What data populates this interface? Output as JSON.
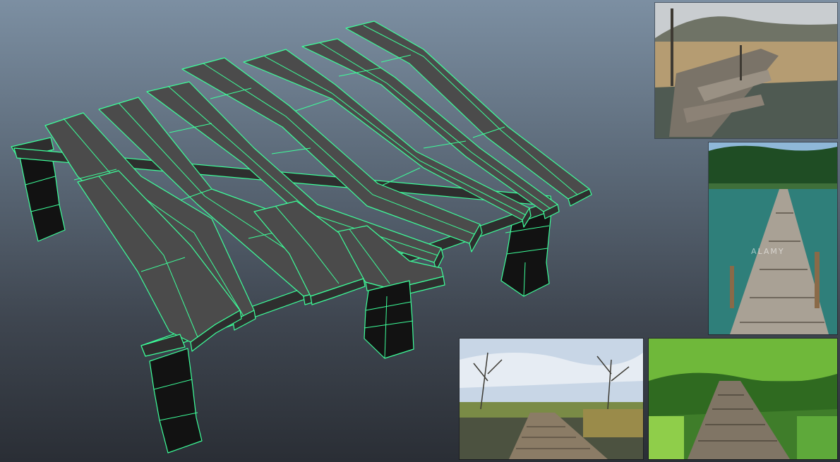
{
  "viewport": {
    "background_top": "#7c8fa2",
    "background_bottom": "#2a2e35",
    "wireframe_color": "#3dff9a",
    "plank_color": "#4a4a4a",
    "post_color": "#141414"
  },
  "model": {
    "name": "wooden-pier-mesh",
    "plank_count": 11,
    "post_count": 4
  },
  "references": [
    {
      "id": "ref-reeds-broken-dock",
      "watermark": ""
    },
    {
      "id": "ref-tropical-lake-boardwalk",
      "watermark": "ALAMY"
    },
    {
      "id": "ref-winter-marsh-boardwalk",
      "watermark": ""
    },
    {
      "id": "ref-jungle-broken-walkway",
      "watermark": ""
    }
  ]
}
